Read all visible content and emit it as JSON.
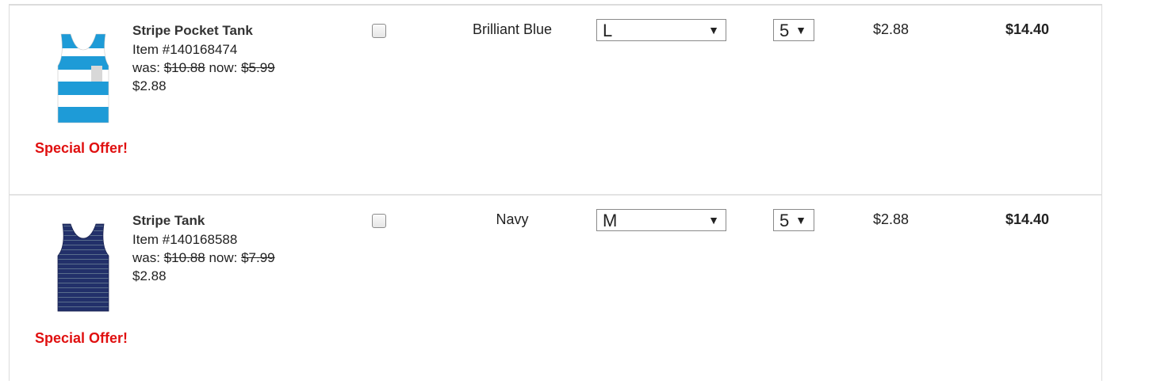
{
  "cart": {
    "items": [
      {
        "name": "Stripe Pocket Tank",
        "item_number": "Item #140168474",
        "was_label": "was:",
        "was_price": "$10.88",
        "now_label": "now:",
        "now_price": "$5.99",
        "sale_price": "$2.88",
        "offer": "Special Offer!",
        "color": "Brilliant Blue",
        "size": "L",
        "quantity": "5",
        "unit_price": "$2.88",
        "total": "$14.40",
        "product_image": "stripe-pocket-tank-image",
        "image_colors": {
          "stripe": "#1e9bd7",
          "pocket": "#d8d8d8"
        }
      },
      {
        "name": "Stripe Tank",
        "item_number": "Item #140168588",
        "was_label": "was:",
        "was_price": "$10.88",
        "now_label": "now:",
        "now_price": "$7.99",
        "sale_price": "$2.88",
        "offer": "Special Offer!",
        "color": "Navy",
        "size": "M",
        "quantity": "5",
        "unit_price": "$2.88",
        "total": "$14.40",
        "product_image": "stripe-tank-image",
        "image_colors": {
          "base": "#22306a",
          "stripe": "#5a6e8c"
        }
      }
    ],
    "select_arrow": "▼",
    "accent_colors": {
      "offer": "#e01010"
    }
  }
}
